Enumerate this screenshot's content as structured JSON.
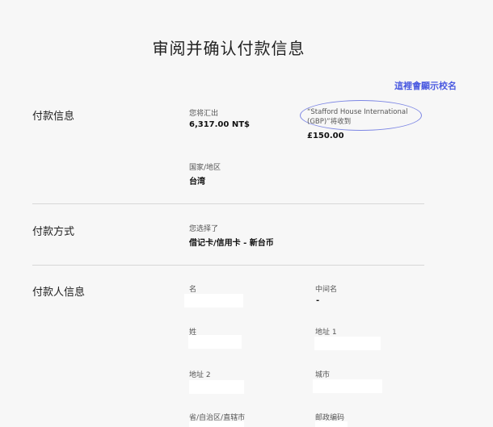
{
  "page": {
    "title": "审阅并确认付款信息"
  },
  "annotation": {
    "text": "這裡會顯示校名"
  },
  "payment_info": {
    "section_label": "付款信息",
    "send_label": "您将汇出",
    "send_amount": "6,317.00 NT$",
    "recipient_label": "“Stafford House International (GBP)”将收到",
    "recipient_amount": "£150.00",
    "country_label": "国家/地区",
    "country_value": "台湾"
  },
  "payment_method": {
    "section_label": "付款方式",
    "chosen_label": "您选择了",
    "chosen_value": "借记卡/信用卡 - 新台币"
  },
  "payer_info": {
    "section_label": "付款人信息",
    "fields": {
      "first_name_label": "名",
      "middle_name_label": "中间名",
      "middle_name_value": "-",
      "last_name_label": "姓",
      "address1_label": "地址 1",
      "address2_label": "地址 2",
      "city_label": "城市",
      "province_label": "省/自治区/直辖市",
      "postcode_label": "邮政编码"
    }
  }
}
